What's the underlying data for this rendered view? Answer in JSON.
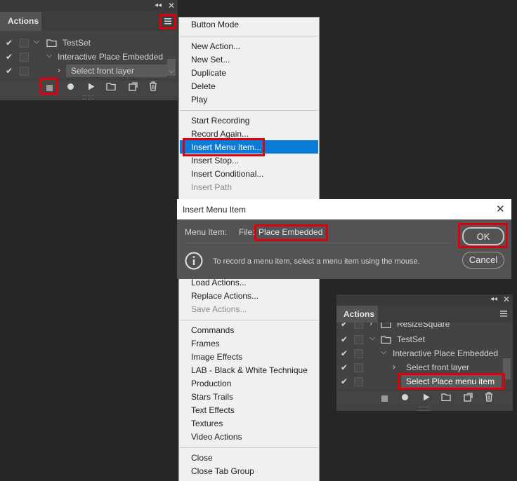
{
  "panel1": {
    "tab": "Actions",
    "rows": [
      {
        "label": "TestSet"
      },
      {
        "label": "Interactive Place Embedded"
      },
      {
        "label": "Select front layer"
      }
    ]
  },
  "menu": {
    "items": [
      "Button Mode",
      "New Action...",
      "New Set...",
      "Duplicate",
      "Delete",
      "Play",
      "Start Recording",
      "Record Again...",
      "Insert Menu Item...",
      "Insert Stop...",
      "Insert Conditional...",
      "Insert Path",
      "Load Actions...",
      "Replace Actions...",
      "Save Actions...",
      "Commands",
      "Frames",
      "Image Effects",
      "LAB - Black & White Technique",
      "Production",
      "Stars Trails",
      "Text Effects",
      "Textures",
      "Video Actions",
      "Close",
      "Close Tab Group"
    ]
  },
  "dialog": {
    "title": "Insert Menu Item",
    "field_label": "Menu Item:",
    "menu_prefix": "File:",
    "menu_value": "Place Embedded",
    "info": "To record a menu item, select a menu item using the mouse.",
    "ok": "OK",
    "cancel": "Cancel"
  },
  "panel2": {
    "tab": "Actions",
    "rows": [
      {
        "label": "ResizeSquare"
      },
      {
        "label": "TestSet"
      },
      {
        "label": "Interactive Place Embedded"
      },
      {
        "label": "Select front layer"
      },
      {
        "label": "Select Place menu item"
      }
    ]
  },
  "colors": {
    "accent_red": "#e0000c",
    "menu_highlight": "#0a7bd6"
  },
  "icons": [
    "collapse-icon",
    "close-icon",
    "panel-menu-icon",
    "check-icon",
    "folder-icon",
    "stop-icon",
    "record-icon",
    "play-icon",
    "new-set-icon",
    "new-action-icon",
    "trash-icon",
    "info-icon"
  ]
}
